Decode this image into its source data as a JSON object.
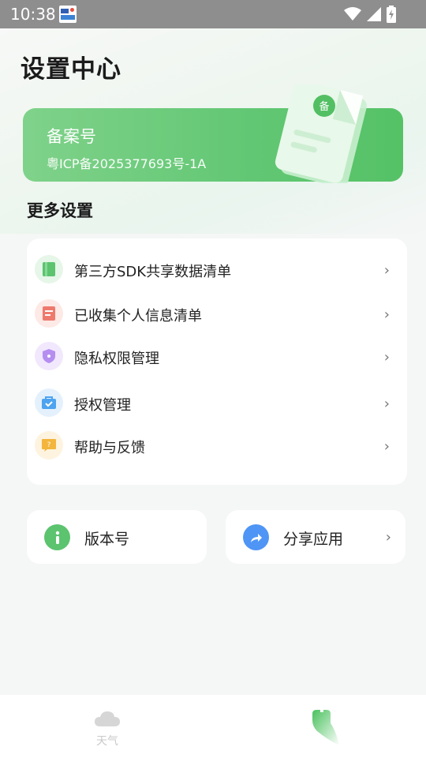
{
  "status_bar": {
    "time": "10:38"
  },
  "header": {
    "title": "设置中心"
  },
  "record_card": {
    "title": "备案号",
    "value": "粤ICP备2025377693号-1A",
    "badge": "备"
  },
  "more_settings": {
    "title": "更多设置",
    "items": [
      {
        "label": "第三方SDK共享数据清单",
        "icon": "green-book-icon",
        "color": "#5cc36f"
      },
      {
        "label": "已收集个人信息清单",
        "icon": "red-document-icon",
        "color": "#ee7a6e"
      },
      {
        "label": "隐私权限管理",
        "icon": "purple-shield-icon",
        "color": "#b58ef0"
      },
      {
        "label": "授权管理",
        "icon": "blue-bag-icon",
        "color": "#4da3f0"
      },
      {
        "label": "帮助与反馈",
        "icon": "yellow-help-icon",
        "color": "#f3b53b"
      }
    ]
  },
  "bottom_cards": {
    "version": {
      "label": "版本号",
      "icon": "info-icon",
      "color": "#5cc36f"
    },
    "share": {
      "label": "分享应用",
      "icon": "share-icon",
      "color": "#4e95f5"
    }
  },
  "tab_bar": {
    "weather": {
      "label": "天气"
    }
  },
  "colors": {
    "accent": "#62c774",
    "background": "#f5f6f6"
  }
}
